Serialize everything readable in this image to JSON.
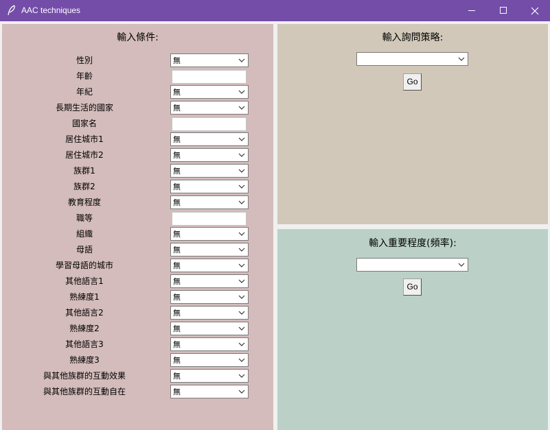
{
  "window": {
    "title": "AAC techniques"
  },
  "conditions": {
    "heading": "輸入條件:",
    "rows": [
      {
        "label": "性別",
        "type": "combo",
        "value": "無"
      },
      {
        "label": "年齡",
        "type": "entry",
        "value": ""
      },
      {
        "label": "年紀",
        "type": "combo",
        "value": "無"
      },
      {
        "label": "長期生活的國家",
        "type": "combo",
        "value": "無"
      },
      {
        "label": "國家名",
        "type": "entry",
        "value": ""
      },
      {
        "label": "居住城市1",
        "type": "combo",
        "value": "無"
      },
      {
        "label": "居住城市2",
        "type": "combo",
        "value": "無"
      },
      {
        "label": "族群1",
        "type": "combo",
        "value": "無"
      },
      {
        "label": "族群2",
        "type": "combo",
        "value": "無"
      },
      {
        "label": "教育程度",
        "type": "combo",
        "value": "無"
      },
      {
        "label": "職等",
        "type": "entry",
        "value": ""
      },
      {
        "label": "組織",
        "type": "combo",
        "value": "無"
      },
      {
        "label": "母語",
        "type": "combo",
        "value": "無"
      },
      {
        "label": "學習母語的城市",
        "type": "combo",
        "value": "無"
      },
      {
        "label": "其他語言1",
        "type": "combo",
        "value": "無"
      },
      {
        "label": "熟練度1",
        "type": "combo",
        "value": "無"
      },
      {
        "label": "其他語言2",
        "type": "combo",
        "value": "無"
      },
      {
        "label": "熟練度2",
        "type": "combo",
        "value": "無"
      },
      {
        "label": "其他語言3",
        "type": "combo",
        "value": "無"
      },
      {
        "label": "熟練度3",
        "type": "combo",
        "value": "無"
      },
      {
        "label": "與其他族群的互動效果",
        "type": "combo",
        "value": "無"
      },
      {
        "label": "與其他族群的互動自在",
        "type": "combo",
        "value": "無"
      }
    ]
  },
  "strategy": {
    "heading": "輸入詢問策略:",
    "selected": "",
    "go_label": "Go"
  },
  "importance": {
    "heading": "輸入重要程度(頻率):",
    "selected": "",
    "go_label": "Go"
  },
  "colors": {
    "titlebar": "#744da9",
    "left_panel": "#d3bcbb",
    "top_right_panel": "#d1c8b9",
    "bottom_right_panel": "#bbd1c8"
  },
  "icons": {
    "app": "feather-icon",
    "minimize": "minimize-icon",
    "maximize": "maximize-icon",
    "close": "close-icon",
    "dropdown": "chevron-down-icon"
  }
}
